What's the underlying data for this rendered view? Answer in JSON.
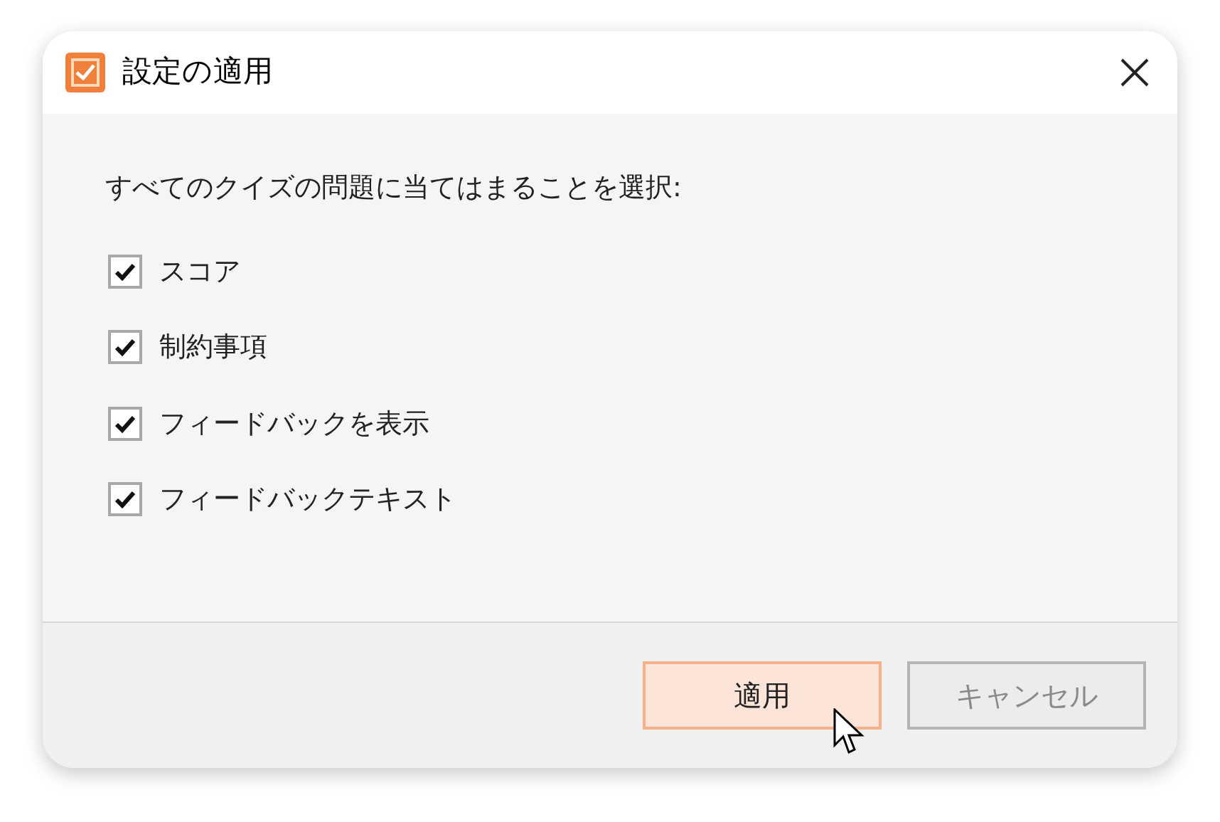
{
  "window": {
    "title": "設定の適用"
  },
  "prompt": "すべてのクイズの問題に当てはまることを選択:",
  "options": [
    {
      "label": "スコア",
      "checked": true
    },
    {
      "label": "制約事項",
      "checked": true
    },
    {
      "label": "フィードバックを表示",
      "checked": true
    },
    {
      "label": "フィードバックテキスト",
      "checked": true
    }
  ],
  "buttons": [
    {
      "label": "適用",
      "kind": "primary"
    },
    {
      "label": "キャンセル",
      "kind": "secondary"
    }
  ]
}
